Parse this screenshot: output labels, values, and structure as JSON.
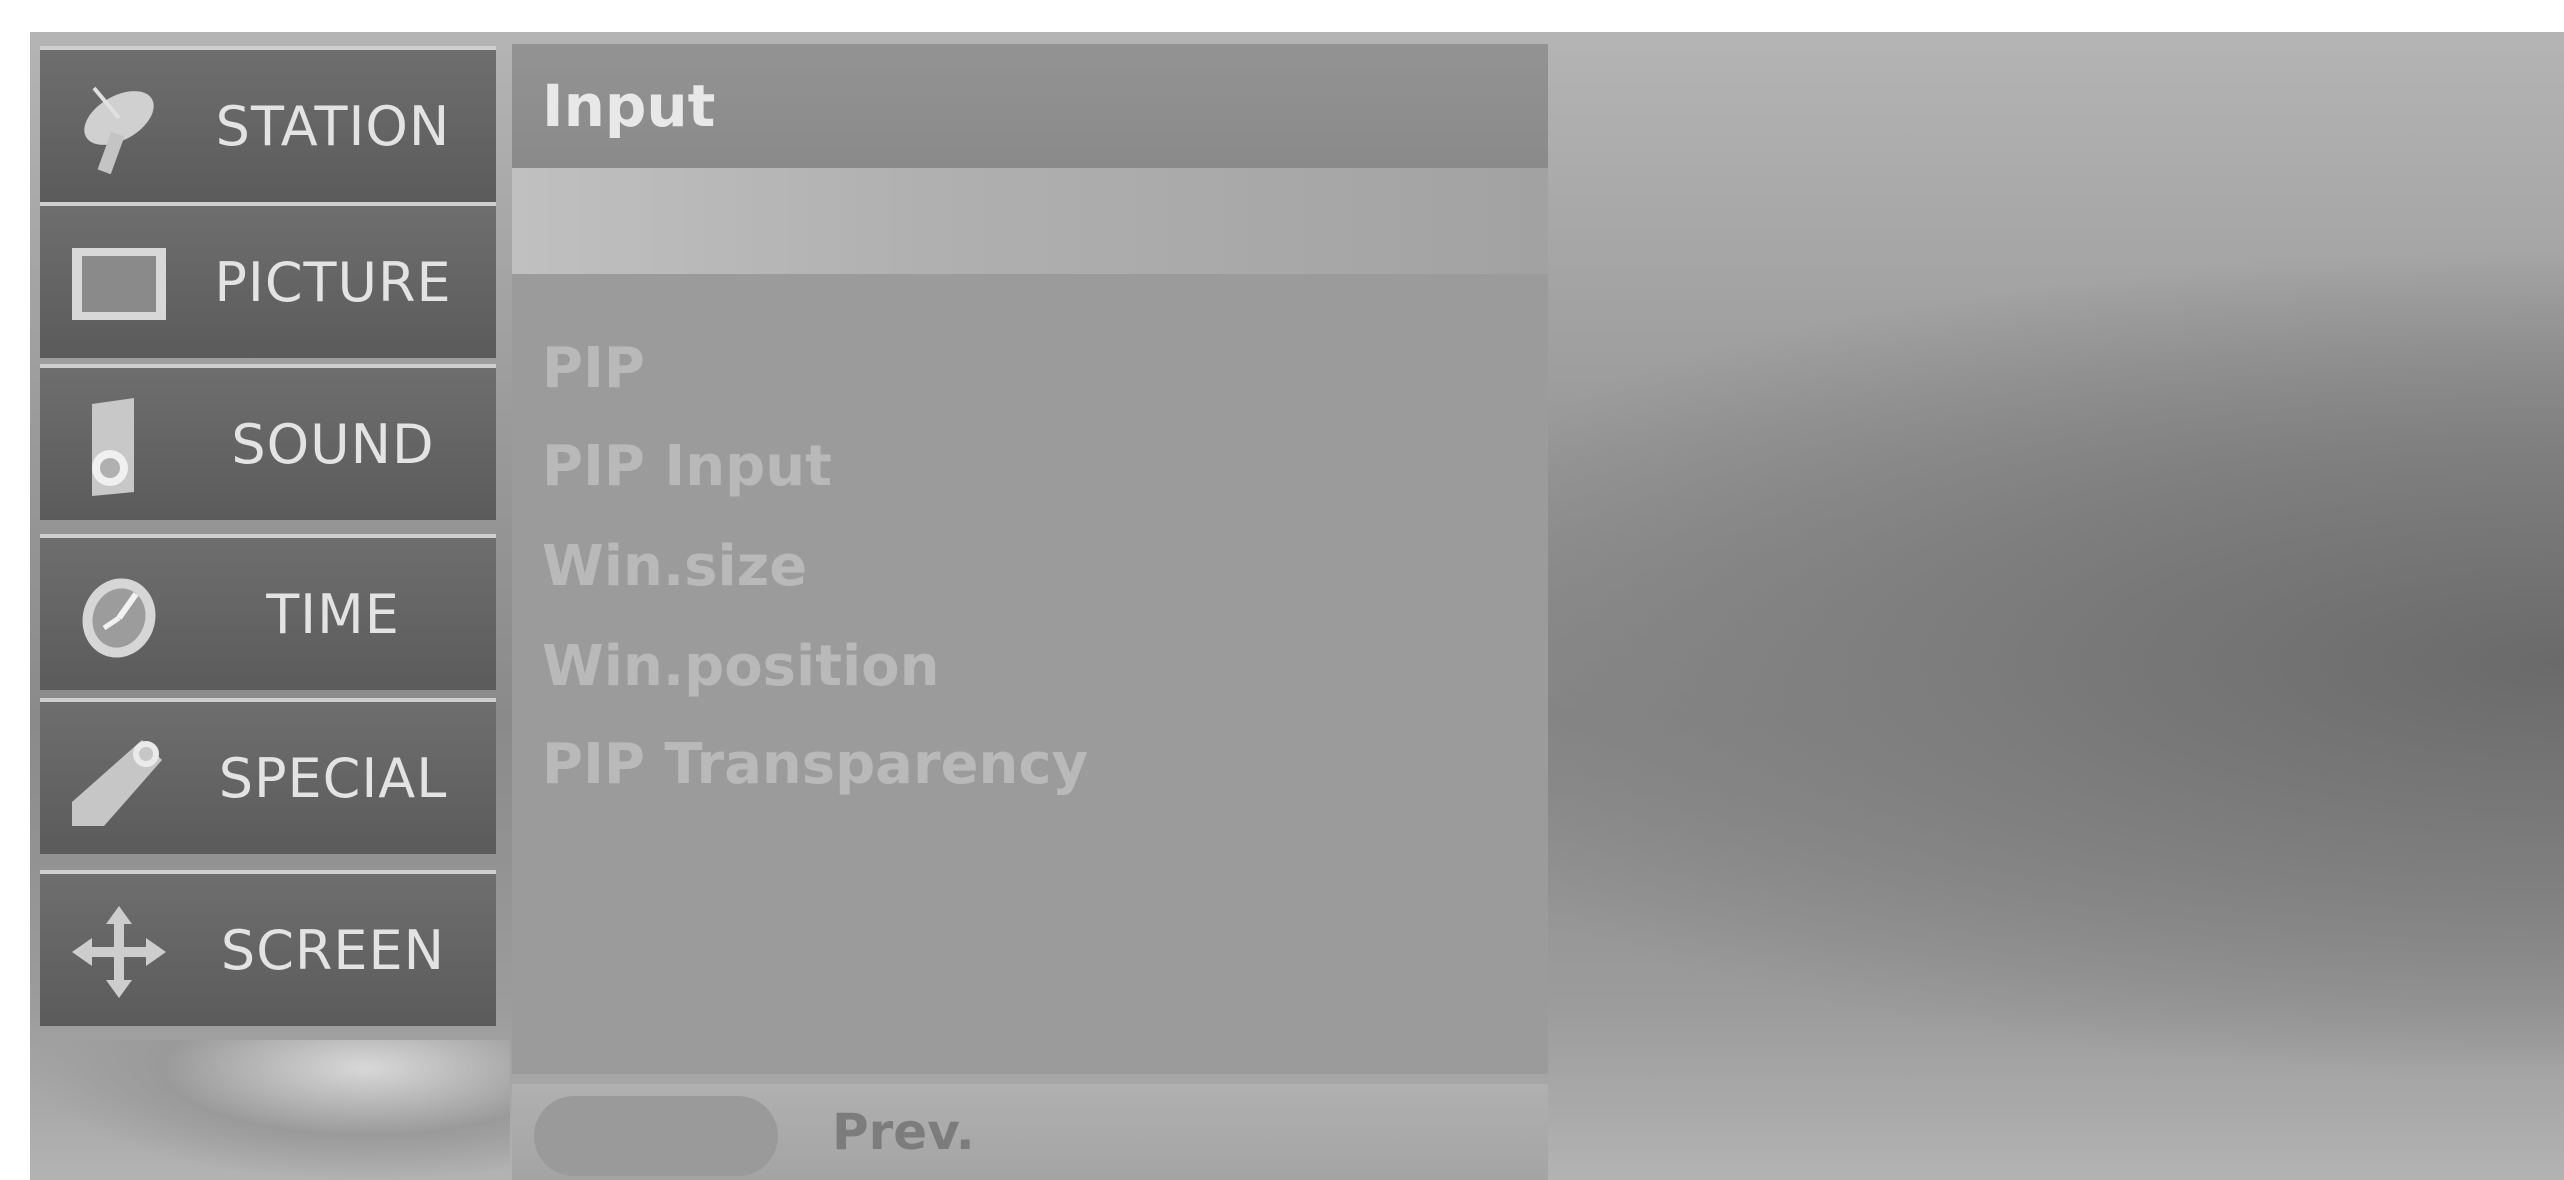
{
  "sidebar": {
    "items": [
      {
        "label": "STATION",
        "icon": "satellite-dish-icon"
      },
      {
        "label": "PICTURE",
        "icon": "picture-frame-icon"
      },
      {
        "label": "SOUND",
        "icon": "speaker-icon"
      },
      {
        "label": "TIME",
        "icon": "clock-icon"
      },
      {
        "label": "SPECIAL",
        "icon": "tag-icon"
      },
      {
        "label": "SCREEN",
        "icon": "move-arrows-icon"
      }
    ]
  },
  "panel": {
    "title": "Input",
    "options": [
      "PIP",
      "PIP Input",
      "Win.size",
      "Win.position",
      "PIP Transparency"
    ]
  },
  "footer": {
    "prev_label": "Prev."
  }
}
